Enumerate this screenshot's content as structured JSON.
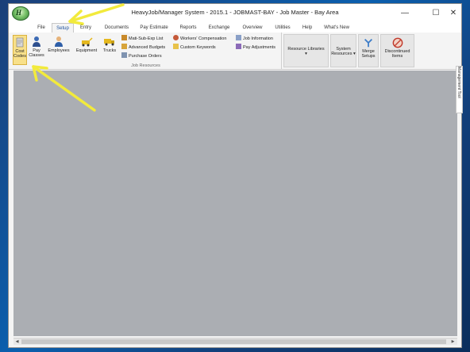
{
  "window": {
    "title": "HeavyJob/Manager System - 2015.1 - JOBMAST-BAY - Job Master - Bay Area",
    "minimize": "—",
    "maximize": "☐",
    "close": "✕"
  },
  "tabs": [
    {
      "label": "File"
    },
    {
      "label": "Setup"
    },
    {
      "label": "Entry"
    },
    {
      "label": "Documents"
    },
    {
      "label": "Pay Estimate"
    },
    {
      "label": "Reports"
    },
    {
      "label": "Exchange"
    },
    {
      "label": "Overview"
    },
    {
      "label": "Utilities"
    },
    {
      "label": "Help"
    },
    {
      "label": "What's New"
    }
  ],
  "ribbon": {
    "job_resources": {
      "label": "Job Resources",
      "cost_codes": [
        "Cost",
        "Codes"
      ],
      "pay_classes": [
        "Pay",
        "Classes"
      ],
      "employees": "Employees",
      "equipment": "Equipment",
      "trucks": "Trucks",
      "mati_sub_exp_list": "Mati-Sub-Exp List",
      "advanced_budgets": "Advanced Budgets",
      "purchase_orders": "Purchase Orders",
      "workers_compensation": "Workers' Compensation",
      "custom_keywords": "Custom Keywords",
      "job_information": "Job Information",
      "pay_adjustments": "Pay Adjustments"
    },
    "resource_libraries": {
      "label": "Resource Libraries",
      "caret": "▾"
    },
    "system_resources": [
      "System",
      "Resources ▾"
    ],
    "merge_setups": [
      "Merge",
      "Setups"
    ],
    "discontinued_items": [
      "Discontinued",
      "Items"
    ]
  },
  "side_panel": {
    "label": "Management Tool"
  },
  "scroll": {
    "left": "◀",
    "right": "▶"
  },
  "colors": {
    "highlight": "#f8e08a",
    "annotation_arrow": "#f2ea3c",
    "workspace": "#abaeb3"
  }
}
